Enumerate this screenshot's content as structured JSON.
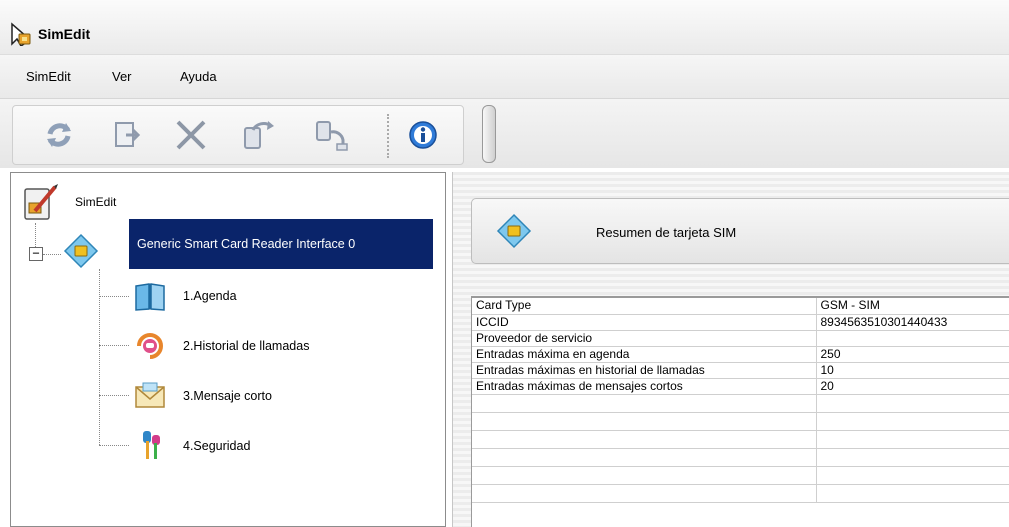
{
  "window": {
    "title": "SimEdit"
  },
  "menu": {
    "items": [
      "SimEdit",
      "Ver",
      "Ayuda"
    ]
  },
  "toolbar": {
    "buttons": [
      "refresh-icon",
      "export-icon",
      "delete-icon",
      "read-card-icon",
      "write-card-icon",
      "info-icon"
    ]
  },
  "tree": {
    "root_label": "SimEdit",
    "reader_label": "Generic Smart Card Reader Interface 0",
    "toggle": "−",
    "children": [
      {
        "label": "1.Agenda",
        "icon": "agenda-book-icon"
      },
      {
        "label": "2.Historial de llamadas",
        "icon": "call-history-icon"
      },
      {
        "label": "3.Mensaje corto",
        "icon": "envelope-icon"
      },
      {
        "label": "4.Seguridad",
        "icon": "keys-icon"
      }
    ]
  },
  "summary": {
    "title": "Resumen de tarjeta SIM"
  },
  "grid": {
    "rows": [
      {
        "label": "Card Type",
        "value": "GSM - SIM"
      },
      {
        "label": "ICCID",
        "value": "8934563510301440433"
      },
      {
        "label": "Proveedor de servicio",
        "value": ""
      },
      {
        "label": "Entradas máxima en agenda",
        "value": "250"
      },
      {
        "label": "Entradas máximas en historial de llamadas",
        "value": "10"
      },
      {
        "label": "Entradas máximas de mensajes cortos",
        "value": "20"
      }
    ]
  },
  "colors": {
    "selection": "#0a246a",
    "accent_yellow": "#f0c020"
  }
}
